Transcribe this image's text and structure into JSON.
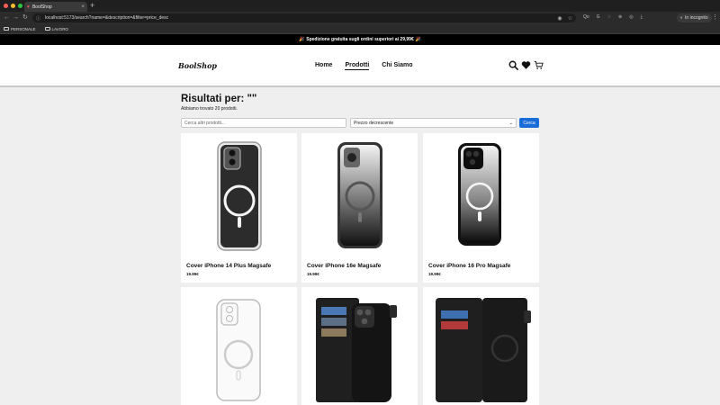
{
  "browser": {
    "tab_title": "BoolShop",
    "url": "localhost:5173/search?name=&description=&filter=price_desc",
    "incognito_label": "In incognito",
    "bookmarks": [
      "PERSONALE",
      "LAVORO"
    ],
    "extensions": [
      "Qo",
      "G",
      "♢",
      "⊕",
      "◎"
    ]
  },
  "promo": {
    "text": "Spedizione gratuita sugli ordini superiori ai 29,99€",
    "icon": "🎉"
  },
  "header": {
    "logo": "BoolShop",
    "nav": [
      {
        "label": "Home",
        "active": false
      },
      {
        "label": "Prodotti",
        "active": true
      },
      {
        "label": "Chi Siamo",
        "active": false
      }
    ],
    "icons": [
      "search-icon",
      "heart-icon",
      "cart-icon"
    ]
  },
  "results": {
    "title": "Risultati per: \"\"",
    "count_text": "Abbiamo trovato 20 prodotti."
  },
  "filters": {
    "search_placeholder": "Cerca altri prodotti...",
    "sort_value": "Prezzo decrescente",
    "search_button": "Cerca"
  },
  "products": [
    {
      "name": "Cover iPhone 14 Plus Magsafe",
      "price": "19.99€",
      "style": "clear"
    },
    {
      "name": "Cover iPhone 16e Magsafe",
      "price": "19.99€",
      "style": "gradient"
    },
    {
      "name": "Cover iPhone 16 Pro Magsafe",
      "price": "19.99€",
      "style": "black-gradient"
    },
    {
      "name": "",
      "price": "",
      "style": "clear-white"
    },
    {
      "name": "",
      "price": "",
      "style": "wallet-phone"
    },
    {
      "name": "",
      "price": "",
      "style": "wallet-open"
    }
  ],
  "colors": {
    "accent": "#1a6cd8",
    "promo_bg": "#000000",
    "page_bg": "#efefef"
  }
}
